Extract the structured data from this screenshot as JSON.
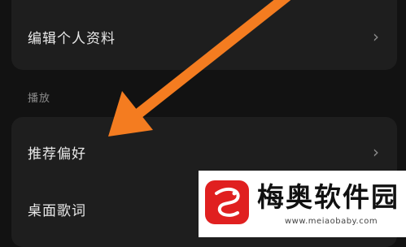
{
  "profile_section": {
    "edit_profile_label": "编辑个人资料"
  },
  "playback_section": {
    "title": "播放",
    "items": [
      {
        "label": "推荐偏好"
      },
      {
        "label": "桌面歌词"
      }
    ]
  },
  "chevron_glyph": "›",
  "watermark": {
    "title": "梅奥软件园",
    "url": "www.meiaobaby.com"
  },
  "colors": {
    "background": "#121212",
    "card": "#1e1e1e",
    "arrow": "#f47c20",
    "watermark_red": "#e02020"
  }
}
